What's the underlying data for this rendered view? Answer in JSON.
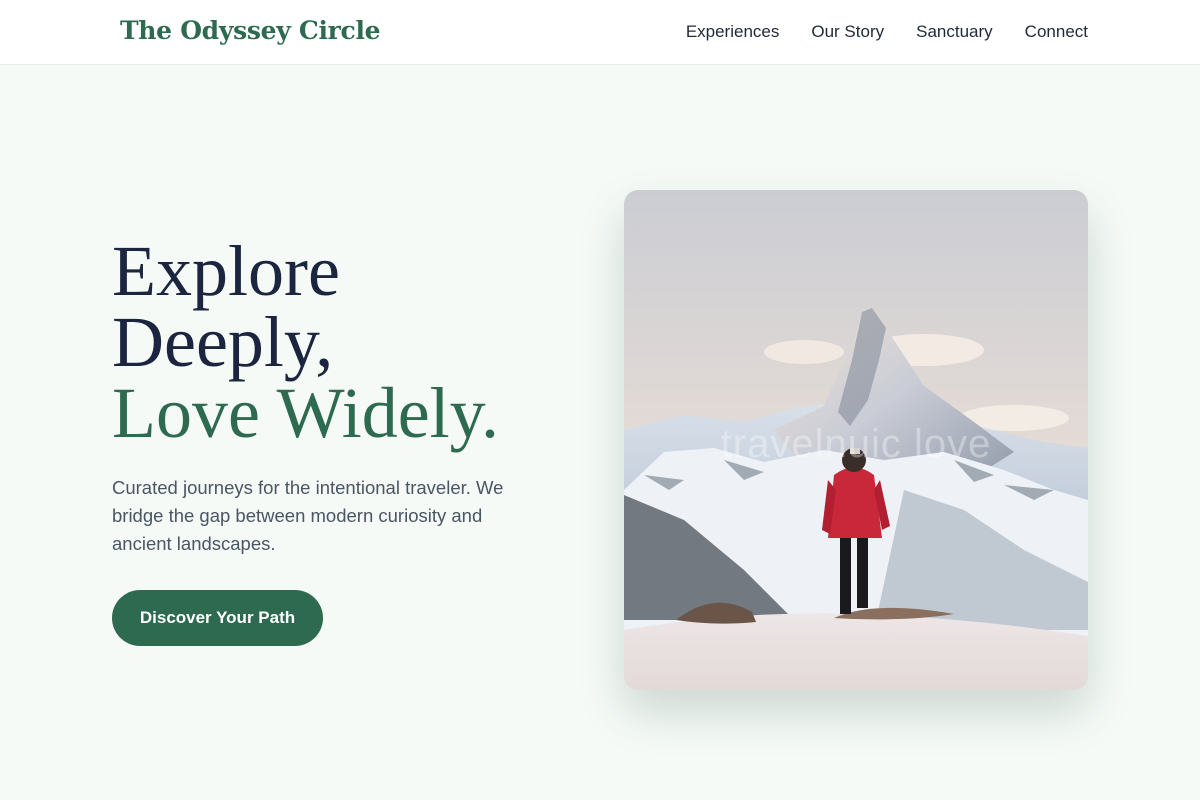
{
  "header": {
    "logo": "The Odyssey Circle",
    "nav": [
      "Experiences",
      "Our Story",
      "Sanctuary",
      "Connect"
    ]
  },
  "hero": {
    "title_lines": [
      "Explore",
      "Deeply,",
      "Love Widely."
    ],
    "subtitle": "Curated journeys for the intentional traveler. We bridge the gap between modern curiosity and ancient landscapes.",
    "cta_label": "Discover Your Path",
    "image_watermark": "travelnuic love"
  },
  "colors": {
    "brand_green": "#2d6a4f",
    "heading_navy": "#1b2540",
    "page_bg": "#f5faf7",
    "jacket_red": "#c8283a"
  }
}
